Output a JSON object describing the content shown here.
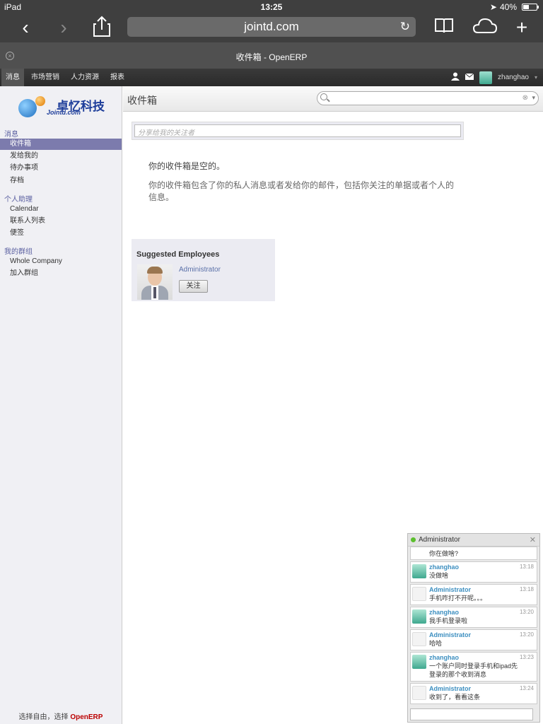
{
  "status": {
    "device": "iPad",
    "time": "13:25",
    "battery": "40%"
  },
  "browser": {
    "url": "jointd.com",
    "tab_title": "收件箱 - OpenERP"
  },
  "topmenu": {
    "items": [
      "消息",
      "市场营销",
      "人力资源",
      "报表"
    ],
    "user": "zhanghao"
  },
  "logo": {
    "title": "卓忆科技",
    "sub": "Jointd.com"
  },
  "sidebar": {
    "sections": [
      {
        "title": "消息",
        "items": [
          "收件箱",
          "发给我的",
          "待办事项",
          "存档"
        ]
      },
      {
        "title": "个人助理",
        "items": [
          "Calendar",
          "联系人列表",
          "便签"
        ]
      },
      {
        "title": "我的群组",
        "items": [
          "Whole Company",
          "加入群组"
        ]
      }
    ],
    "active_item": "收件箱",
    "footer_text": "选择自由，选择",
    "footer_brand": "OpenERP"
  },
  "main": {
    "title": "收件箱",
    "search_placeholder": "",
    "share_placeholder": "分享给我的关注者",
    "empty_title": "你的收件箱是空的。",
    "empty_desc": "你的收件箱包含了你的私人消息或者发给你的邮件，包括你关注的单据或者个人的信息。"
  },
  "suggest": {
    "heading": "Suggested Employees",
    "name": "Administrator",
    "follow_label": "关注"
  },
  "chat": {
    "title": "Administrator",
    "partial_text": "你在做啥?",
    "messages": [
      {
        "who": "zhanghao",
        "time": "13:18",
        "text": "没做啥",
        "kind": "user"
      },
      {
        "who": "Administrator",
        "time": "13:18",
        "text": "手机咋打不开呢。。。",
        "kind": "admin"
      },
      {
        "who": "zhanghao",
        "time": "13:20",
        "text": "我手机登录啦",
        "kind": "user"
      },
      {
        "who": "Administrator",
        "time": "13:20",
        "text": "哈哈",
        "kind": "admin"
      },
      {
        "who": "zhanghao",
        "time": "13:23",
        "text": "一个账户同时登录手机和ipad先登录的那个收到消息",
        "kind": "user"
      },
      {
        "who": "Administrator",
        "time": "13:24",
        "text": "收到了，看看这条",
        "kind": "admin"
      }
    ]
  }
}
